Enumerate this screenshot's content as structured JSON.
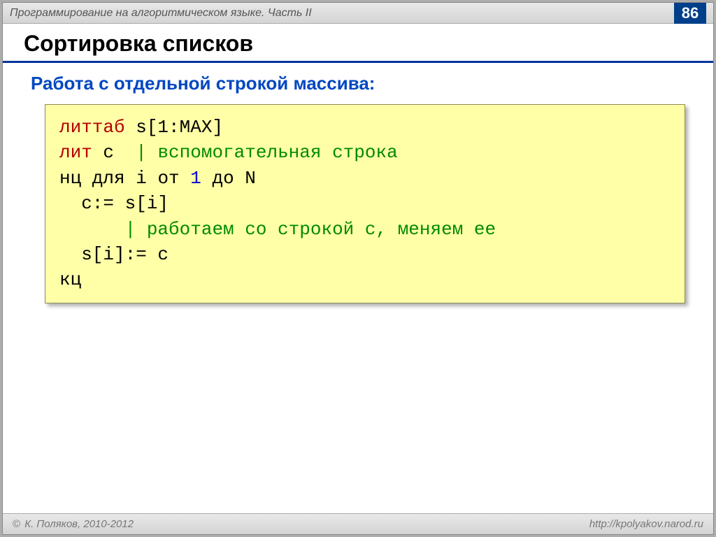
{
  "header": {
    "title": "Программирование на алгоритмическом языке. Часть II",
    "pageNumber": "86"
  },
  "slide": {
    "title": "Сортировка списков",
    "subtitle": "Работа с отдельной строкой массива:"
  },
  "code": {
    "l1_kw": "литтаб",
    "l1_rest": " s[1:MAX]",
    "l2_kw": "лит",
    "l2_rest": " c  ",
    "l2_comment": "| вспомогательная строка",
    "l3_a": "нц для",
    "l3_b": " i ",
    "l3_c": "от",
    "l3_d": " 1 ",
    "l3_e": "до",
    "l3_f": " N",
    "l4": "  c:= s[i]",
    "l5_pad": "      ",
    "l5_comment": "| работаем со строкой c, меняем ее",
    "l6": "  s[i]:= c",
    "l7": "кц"
  },
  "footer": {
    "copyrightSymbol": "©",
    "copyright": " К. Поляков, 2010-2012",
    "url": "http://kpolyakov.narod.ru"
  }
}
